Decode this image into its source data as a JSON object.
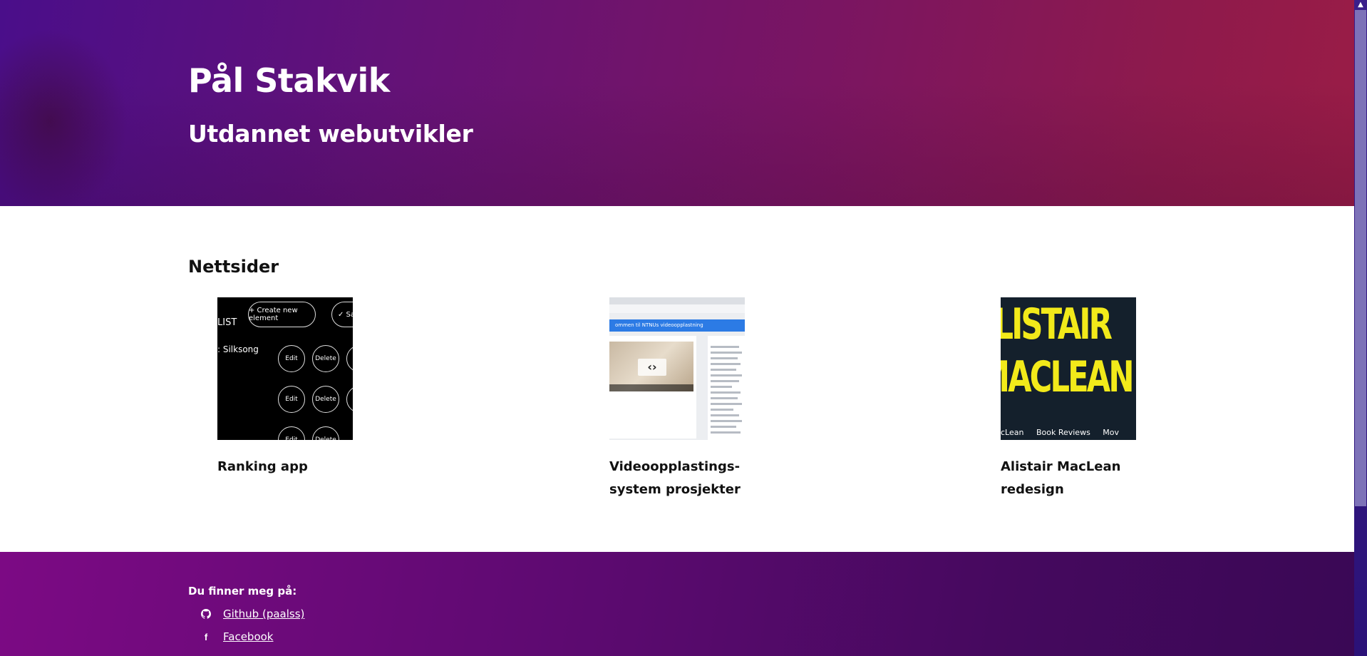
{
  "header": {
    "name": "Pål Stakvik",
    "tagline": "Utdannet webutvikler"
  },
  "main": {
    "section_title": "Nettsider",
    "projects": [
      {
        "title": "Ranking app",
        "thumb": {
          "create_button": "+ Create new element",
          "save_button": "✓ Save",
          "list_text": "LIST",
          "item_text": ": Silksong",
          "edit_label": "Edit",
          "delete_label": "Delete"
        }
      },
      {
        "title": "Videoopplastings-system prosjekter",
        "thumb": {
          "bar_text": "ommen til NTNUs videoopplastning"
        }
      },
      {
        "title": "Alistair MacLean redesign",
        "thumb": {
          "line1": "ALISTAIR",
          "line2": "MACLEAN",
          "nav_text": "cLean     Book Reviews     Mov"
        }
      }
    ]
  },
  "footer": {
    "label": "Du finner meg på:",
    "links": [
      {
        "icon": "github-icon",
        "text": "Github (paalss)"
      },
      {
        "icon": "facebook-icon",
        "text": "Facebook"
      }
    ]
  },
  "colors": {
    "hero_start": "#4a0e8a",
    "hero_end": "#9a1c46",
    "footer_start": "#7c0a84",
    "footer_end": "#3a0855",
    "maclean_yellow": "#f2ea1a"
  }
}
